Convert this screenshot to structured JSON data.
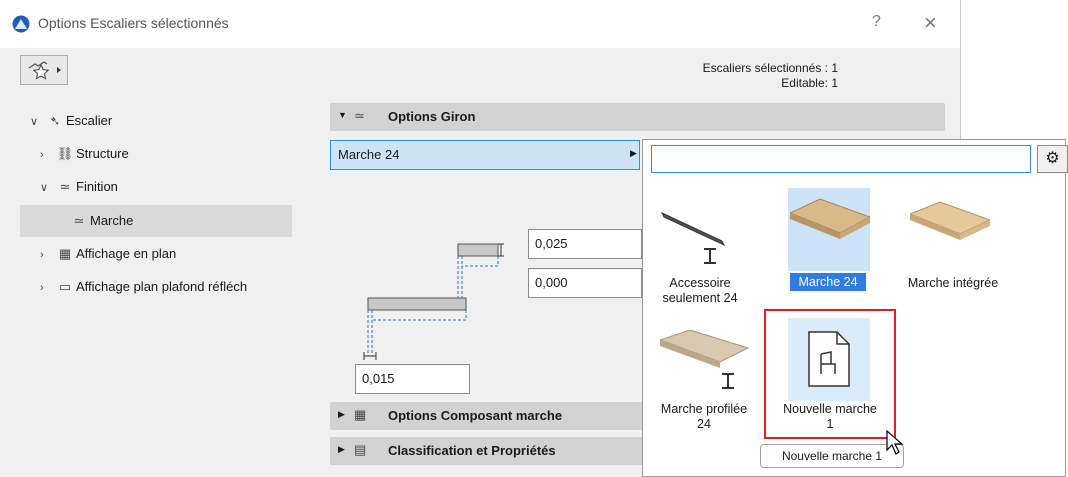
{
  "window": {
    "title": "Options Escaliers sélectionnés",
    "help_label": "?",
    "close_label": "×"
  },
  "header": {
    "selected_count": "Escaliers sélectionnés : 1",
    "editable_count": "Editable: 1"
  },
  "tree": {
    "items": [
      {
        "label": "Escalier",
        "expanded": true,
        "icon": "stair-icon"
      },
      {
        "label": "Structure",
        "expanded": false,
        "icon": "structure-icon"
      },
      {
        "label": "Finition",
        "expanded": true,
        "icon": "finish-icon"
      },
      {
        "label": "Marche",
        "selected": true,
        "icon": "tread-icon"
      },
      {
        "label": "Affichage en plan",
        "expanded": false,
        "icon": "floor-plan-icon"
      },
      {
        "label": "Affichage plan plafond réfléch",
        "expanded": false,
        "icon": "ceiling-plan-icon"
      }
    ]
  },
  "sections": {
    "giron": "Options Giron",
    "composant": "Options Composant marche",
    "classification": "Classification et Propriétés"
  },
  "tread_select": {
    "value": "Marche 24"
  },
  "fields": {
    "top_thickness": "0,025",
    "offset": "0,000",
    "nosing": "0,015"
  },
  "popup": {
    "search_value": "",
    "tiles": [
      {
        "label": "Accessoire seulement 24",
        "lines": [
          "Accessoire",
          "seulement 24"
        ]
      },
      {
        "label": "Marche 24",
        "lines": [
          "Marche 24"
        ],
        "selected": true
      },
      {
        "label": "Marche intégrée",
        "lines": [
          "Marche intégrée"
        ]
      },
      {
        "label": "Marche profilée 24",
        "lines": [
          "Marche profilée",
          "24"
        ]
      },
      {
        "label": "Nouvelle marche 1",
        "lines": [
          "Nouvelle marche",
          "1"
        ],
        "highlighted": true
      }
    ],
    "tooltip": "Nouvelle marche 1"
  },
  "colors": {
    "accent": "#2f7de1",
    "highlight": "#e02020",
    "selection_bg": "#cce3f8"
  }
}
